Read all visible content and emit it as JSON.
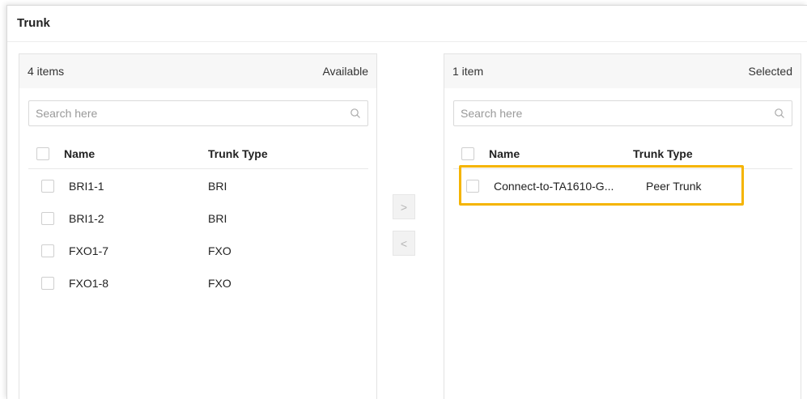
{
  "title": "Trunk",
  "left": {
    "count": "4 items",
    "label": "Available",
    "search_placeholder": "Search here",
    "columns": [
      "Name",
      "Trunk Type"
    ],
    "rows": [
      {
        "name": "BRI1-1",
        "type": "BRI"
      },
      {
        "name": "BRI1-2",
        "type": "BRI"
      },
      {
        "name": "FXO1-7",
        "type": "FXO"
      },
      {
        "name": "FXO1-8",
        "type": "FXO"
      }
    ]
  },
  "right": {
    "count": "1 item",
    "label": "Selected",
    "search_placeholder": "Search here",
    "columns": [
      "Name",
      "Trunk Type"
    ],
    "rows": [
      {
        "name": "Connect-to-TA1610-G...",
        "type": "Peer Trunk"
      }
    ]
  },
  "buttons": {
    "move_right": ">",
    "move_left": "<"
  },
  "colors": {
    "highlight": "#f5b400",
    "panel_header_bg": "#f7f7f7"
  }
}
